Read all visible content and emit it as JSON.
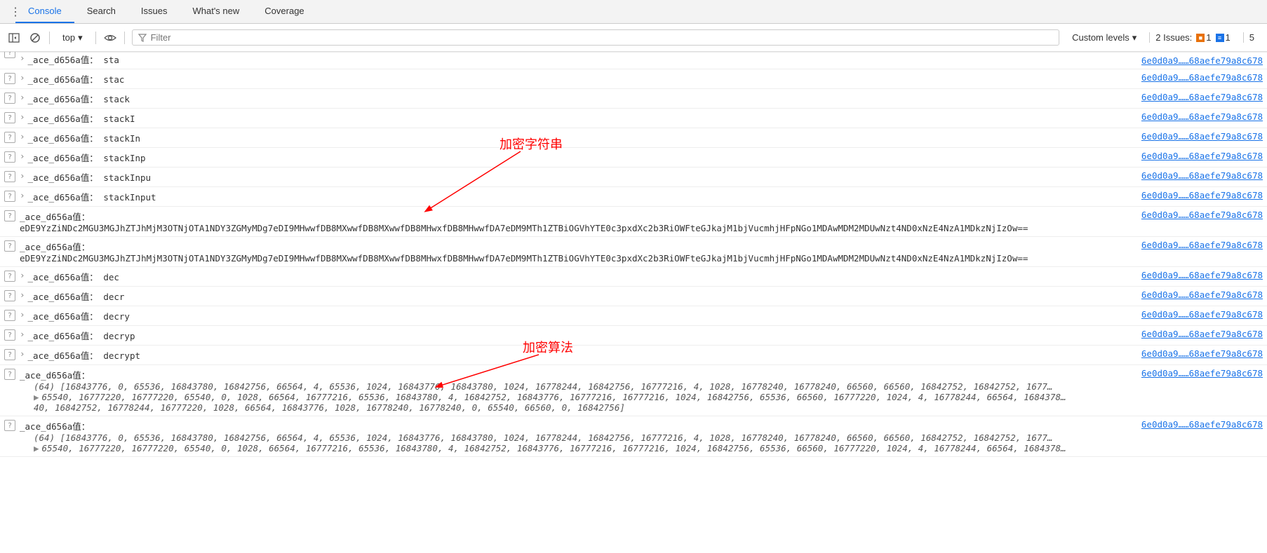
{
  "tabs": [
    "Console",
    "Search",
    "Issues",
    "What's new",
    "Coverage"
  ],
  "active_tab": "Console",
  "toolbar": {
    "context": "top",
    "filter_placeholder": "Filter",
    "levels": "Custom levels",
    "issues_label": "2 Issues:",
    "issue_orange": "1",
    "issue_blue": "1",
    "hidden_count": "5"
  },
  "link_text": "6e0d0a9……68aefe79a8c678",
  "prefix": "_ace_d656a值：",
  "annotations": {
    "str": "加密字符串",
    "algo": "加密算法"
  },
  "rows": [
    {
      "val": "sta",
      "cut": true
    },
    {
      "val": "stac"
    },
    {
      "val": "stack"
    },
    {
      "val": "stackI"
    },
    {
      "val": "stackIn"
    },
    {
      "val": "stackInp"
    },
    {
      "val": "stackInpu"
    },
    {
      "val": "stackInput"
    },
    {
      "val": "eDE9YzZiNDc2MGU3MGJhZTJhMjM3OTNjOTA1NDY3ZGMyMDg7eDI9MHwwfDB8MXwwfDB8MXwwfDB8MHwxfDB8MHwwfDA7eDM9MTh1ZTBiOGVhYTE0c3pxdXc2b3RiOWFteGJkajM1bjVucmhjHFpNGo1MDAwMDM2MDUwNzt4ND0xNzE4NzA1MDkzNjIzOw==",
      "multi": true
    },
    {
      "val": "eDE9YzZiNDc2MGU3MGJhZTJhMjM3OTNjOTA1NDY3ZGMyMDg7eDI9MHwwfDB8MXwwfDB8MXwwfDB8MHwxfDB8MHwwfDA7eDM9MTh1ZTBiOGVhYTE0c3pxdXc2b3RiOWFteGJkajM1bjVucmhjHFpNGo1MDAwMDM2MDUwNzt4ND0xNzE4NzA1MDkzNjIzOw==",
      "multi": true
    },
    {
      "val": "dec"
    },
    {
      "val": "decr"
    },
    {
      "val": "decry"
    },
    {
      "val": "decryp"
    },
    {
      "val": "decrypt"
    },
    {
      "array": true,
      "len": "(64)",
      "content": "[16843776, 0, 65536, 16843780, 16842756, 66564, 4, 65536, 1024, 16843776, 16843780, 1024, 16778244, 16842756, 16777216, 4, 1028, 16778240, 16778240, 66560, 66560, 16842752, 16842752, 1677…",
      "line2": "65540,  16777220,  16777220,  65540,  0,  1028,  66564,  16777216,  65536,  16843780,  4,  16842752,  16843776,  16777216,  16777216,  1024,  16842756,  65536,  66560,  16777220,  1024,  4,  16778244,  66564,  1684378…",
      "line3": "40,  16842752,  16778244,  16777220,  1028,  66564,  16843776,  1028,  16778240,  16778240,  0,  65540,  66560,  0,  16842756]"
    },
    {
      "array": true,
      "len": "(64)",
      "content": "[16843776, 0, 65536, 16843780, 16842756, 66564, 4, 65536, 1024, 16843776, 16843780, 1024, 16778244, 16842756, 16777216, 4, 1028, 16778240, 16778240, 66560, 66560, 16842752, 16842752, 1677…",
      "line2": "65540,  16777220,  16777220,  65540,  0,  1028,  66564,  16777216,  65536,  16843780,  4,  16842752,  16843776,  16777216,  16777216,  1024,  16842756,  65536,  66560,  16777220,  1024,  4,  16778244,  66564,  1684378…"
    }
  ]
}
